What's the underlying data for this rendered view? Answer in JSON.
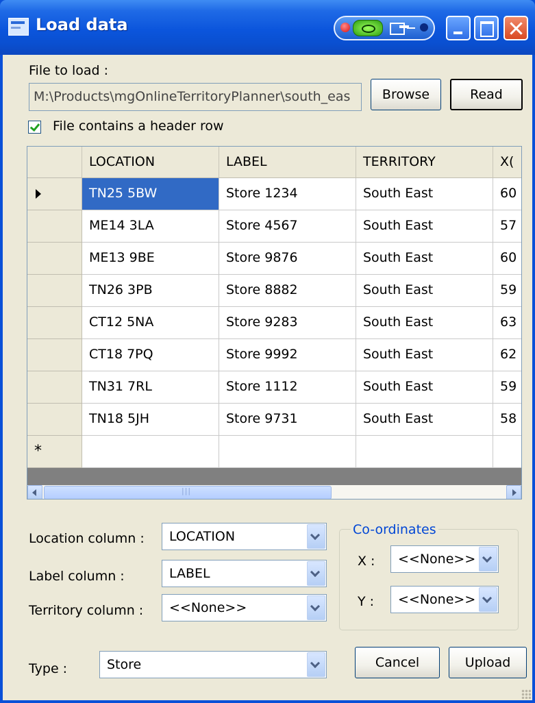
{
  "window": {
    "title": "Load data"
  },
  "file": {
    "label": "File to load :",
    "path": "M:\\Products\\mgOnlineTerritoryPlanner\\south_eas",
    "browse_label": "Browse",
    "read_label": "Read"
  },
  "header_row": {
    "label": "File contains a header row",
    "checked": true
  },
  "grid": {
    "columns": [
      "LOCATION",
      "LABEL",
      "TERRITORY",
      "X("
    ],
    "rows": [
      [
        "TN25 5BW",
        "Store 1234",
        "South East",
        "60"
      ],
      [
        "ME14 3LA",
        "Store 4567",
        "South East",
        "57"
      ],
      [
        "ME13 9BE",
        "Store 9876",
        "South East",
        "60"
      ],
      [
        "TN26 3PB",
        "Store 8882",
        "South East",
        "59"
      ],
      [
        "CT12 5NA",
        "Store 9283",
        "South East",
        "63"
      ],
      [
        "CT18 7PQ",
        "Store 9992",
        "South East",
        "62"
      ],
      [
        "TN31 7RL",
        "Store 1112",
        "South East",
        "59"
      ],
      [
        "TN18 5JH",
        "Store 9731",
        "South East",
        "58"
      ]
    ],
    "new_row_marker": "*"
  },
  "mapping": {
    "location_label": "Location column :",
    "location_value": "LOCATION",
    "label_label": "Label column :",
    "label_value": "LABEL",
    "territory_label": "Territory column :",
    "territory_value": "<<None>>"
  },
  "coordinates": {
    "title": "Co-ordinates",
    "x_label": "X :",
    "x_value": "<<None>>",
    "y_label": "Y :",
    "y_value": "<<None>>"
  },
  "type": {
    "label": "Type :",
    "value": "Store"
  },
  "actions": {
    "cancel_label": "Cancel",
    "upload_label": "Upload"
  },
  "colors": {
    "titlebar": "#0a50d8",
    "selection": "#316ac5",
    "face": "#ece9d8",
    "group_title": "#0046d5"
  }
}
